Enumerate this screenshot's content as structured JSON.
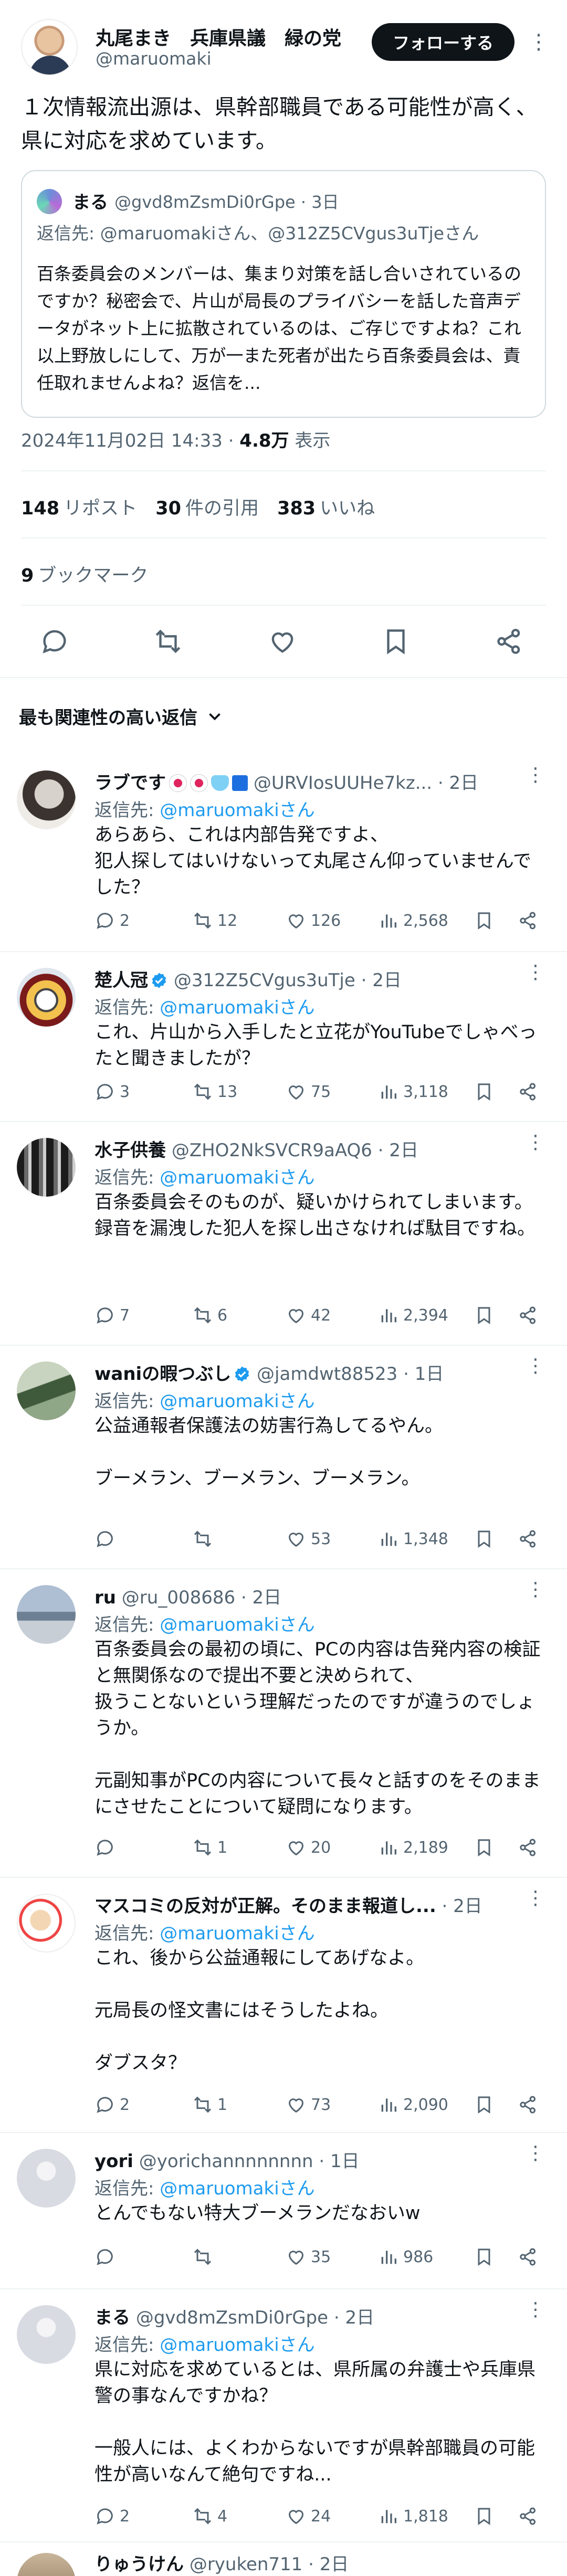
{
  "main_tweet": {
    "name": "丸尾まき　兵庫県議　緑の党",
    "handle": "@maruomaki",
    "follow_label": "フォローする",
    "text": "１次情報流出源は、県幹部職員である可能性が高く、県に対応を求めています。",
    "quote": {
      "name": "まる",
      "handle_time": "@gvd8mZsmDi0rGpe · 3日",
      "reply_to": "返信先: @maruomakiさん、@312Z5CVgus3uTjeさん",
      "body": "百条委員会のメンバーは、集まり対策を話し合いされているのですか？秘密会で、片山が局長のプライバシーを話した音声データがネット上に拡散されているのは、ご存じですよね？これ以上野放しにして、万が一また死者が出たら百条委員会は、責任取れませんよね？返信を..."
    },
    "timestamp": "2024年11月02日 14:33",
    "views_count": "4.8万",
    "views_label": "表示",
    "reposts_count": "148",
    "reposts_label": "リポスト",
    "quotes_count": "30",
    "quotes_label": "件の引用",
    "likes_count": "383",
    "likes_label": "いいね",
    "bookmarks_count": "9",
    "bookmarks_label": "ブックマーク"
  },
  "sort_label": "最も関連性の高い返信",
  "replies": [
    {
      "name": "ラブです",
      "handle_time": "@URVIosUUHe7kz... · 2日",
      "reply_prefix": "返信先: ",
      "reply_target": "@maruomakiさん",
      "body": "あらあら、これは内部告発ですよ、\n犯人探してはいけないって丸尾さん仰っていませんでした？",
      "replies": "2",
      "reposts": "12",
      "likes": "126",
      "views": "2,568"
    },
    {
      "name": "楚人冠",
      "handle_time": "@312Z5CVgus3uTje · 2日",
      "reply_prefix": "返信先: ",
      "reply_target": "@maruomakiさん",
      "body": "これ、片山から入手したと立花がYouTubeでしゃべったと聞きましたが？",
      "replies": "3",
      "reposts": "13",
      "likes": "75",
      "views": "3,118"
    },
    {
      "name": "水子供養",
      "handle_time": "@ZHO2NkSVCR9aAQ6 · 2日",
      "reply_prefix": "返信先: ",
      "reply_target": "@maruomakiさん",
      "body": "百条委員会そのものが、疑いかけられてしまいます。\n録音を漏洩した犯人を探し出さなければ駄目ですね。",
      "replies": "7",
      "reposts": "6",
      "likes": "42",
      "views": "2,394"
    },
    {
      "name": "waniの暇つぶし",
      "handle_time": "@jamdwt88523 · 1日",
      "reply_prefix": "返信先: ",
      "reply_target": "@maruomakiさん",
      "body": "公益通報者保護法の妨害行為してるやん。\n\nブーメラン、ブーメラン、ブーメラン。",
      "replies": "",
      "reposts": "",
      "likes": "53",
      "views": "1,348"
    },
    {
      "name": "ru",
      "handle_time": "@ru_008686 · 2日",
      "reply_prefix": "返信先: ",
      "reply_target": "@maruomakiさん",
      "body": "百条委員会の最初の頃に、PCの内容は告発内容の検証と無関係なので提出不要と決められて、\n扱うことないという理解だったのですが違うのでしょうか。\n\n元副知事がPCの内容について長々と話すのをそのままにさせたことについて疑問になります。",
      "replies": "",
      "reposts": "1",
      "likes": "20",
      "views": "2,189"
    },
    {
      "name": "マスコミの反対が正解。そのまま報道し...",
      "handle_time": " · 2日",
      "reply_prefix": "返信先: ",
      "reply_target": "@maruomakiさん",
      "body": "これ、後から公益通報にしてあげなよ。\n\n元局長の怪文書にはそうしたよね。\n\nダブスタ？",
      "replies": "2",
      "reposts": "1",
      "likes": "73",
      "views": "2,090"
    },
    {
      "name": "yori",
      "handle_time": "@yorichannnnnnnn · 1日",
      "reply_prefix": "返信先: ",
      "reply_target": "@maruomakiさん",
      "body": "とんでもない特大ブーメランだなおいw",
      "replies": "",
      "reposts": "",
      "likes": "35",
      "views": "986"
    },
    {
      "name": "まる",
      "handle_time": "@gvd8mZsmDi0rGpe · 2日",
      "reply_prefix": "返信先: ",
      "reply_target": "@maruomakiさん",
      "body": "県に対応を求めているとは、県所属の弁護士や兵庫県警の事なんですかね？\n\n一般人には、よくわからないですが県幹部職員の可能性が高いなんて絶句ですね...",
      "replies": "2",
      "reposts": "4",
      "likes": "24",
      "views": "1,818"
    },
    {
      "name": "りゅうけん",
      "handle_time": "@ryuken711 · 2日",
      "reply_prefix": "",
      "reply_target": "",
      "body": "",
      "replies": "",
      "reposts": "",
      "likes": "",
      "views": ""
    }
  ],
  "colors": {
    "text": "#0f1419",
    "secondary": "#536471",
    "link": "#1d9bf0",
    "border": "#eff3f4",
    "verified": "#1d9bf0"
  }
}
